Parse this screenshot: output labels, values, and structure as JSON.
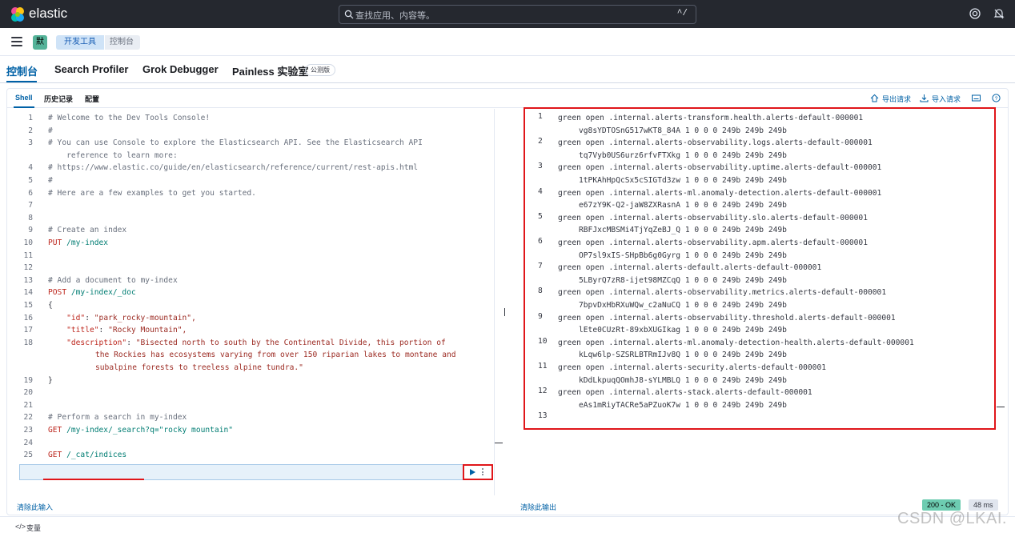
{
  "header": {
    "brand": "elastic",
    "search_placeholder": "查找应用、内容等。",
    "search_shortcut": "^/"
  },
  "breadcrumbs": {
    "space_initial": "默",
    "items": [
      "开发工具",
      "控制台"
    ]
  },
  "app_tabs": [
    {
      "label": "控制台",
      "active": true
    },
    {
      "label": "Search Profiler",
      "active": false
    },
    {
      "label": "Grok Debugger",
      "active": false
    },
    {
      "label": "Painless 实验室",
      "active": false
    }
  ],
  "beta_badge": "公测版",
  "console_tabs": [
    {
      "label": "Shell",
      "active": true
    },
    {
      "label": "历史记录",
      "active": false
    },
    {
      "label": "配置",
      "active": false
    }
  ],
  "toolbar": {
    "export_label": "导出请求",
    "import_label": "导入请求"
  },
  "editor": {
    "lines": [
      {
        "n": "1",
        "text": "# Welcome to the Dev Tools Console!"
      },
      {
        "n": "2",
        "text": "#"
      },
      {
        "n": "3",
        "text": "# You can use Console to explore the Elasticsearch API. See the Elasticsearch API"
      },
      {
        "n": "",
        "text": "    reference to learn more:"
      },
      {
        "n": "4",
        "text": "# https://www.elastic.co/guide/en/elasticsearch/reference/current/rest-apis.html"
      },
      {
        "n": "5",
        "text": "#"
      },
      {
        "n": "6",
        "text": "# Here are a few examples to get you started."
      },
      {
        "n": "7",
        "text": ""
      },
      {
        "n": "8",
        "text": ""
      },
      {
        "n": "9",
        "text": "# Create an index"
      },
      {
        "n": "10",
        "method": "PUT",
        "url": " /my-index"
      },
      {
        "n": "11",
        "text": ""
      },
      {
        "n": "12",
        "text": ""
      },
      {
        "n": "13",
        "text": "# Add a document to my-index"
      },
      {
        "n": "14",
        "method": "POST",
        "url": " /my-index/_doc"
      },
      {
        "n": "15",
        "text": "{"
      },
      {
        "n": "16",
        "key": "\"id\"",
        "val": "\"park_rocky-mountain\","
      },
      {
        "n": "17",
        "key": "\"title\"",
        "val": "\"Rocky Mountain\","
      },
      {
        "n": "18",
        "key": "\"description\"",
        "val": "\"Bisected north to south by the Continental Divide, this portion of"
      },
      {
        "n": "",
        "str": "the Rockies has ecosystems varying from over 150 riparian lakes to montane and"
      },
      {
        "n": "",
        "str": "subalpine forests to treeless alpine tundra.\""
      },
      {
        "n": "19",
        "text": "}"
      },
      {
        "n": "20",
        "text": ""
      },
      {
        "n": "21",
        "text": ""
      },
      {
        "n": "22",
        "text": "# Perform a search in my-index"
      },
      {
        "n": "23",
        "method": "GET",
        "url": " /my-index/_search?q=\"rocky mountain\""
      },
      {
        "n": "24",
        "text": ""
      },
      {
        "n": "25",
        "method": "GET",
        "url": " /_cat/indices",
        "active": true
      }
    ],
    "clear_label": "清除此输入"
  },
  "output": {
    "lines": [
      {
        "n": "1",
        "a": "green open .internal.alerts-transform.health.alerts-default-000001",
        "b": "vg8sYDTOSnG517wKT8_84A 1 0 0 0 249b 249b 249b"
      },
      {
        "n": "2",
        "a": "green open .internal.alerts-observability.logs.alerts-default-000001",
        "b": "tq7Vyb0US6urz6rfvFTXkg 1 0 0 0 249b 249b 249b"
      },
      {
        "n": "3",
        "a": "green open .internal.alerts-observability.uptime.alerts-default-000001",
        "b": "1tPKAhHpQcSx5cSIGTd3zw 1 0 0 0 249b 249b 249b"
      },
      {
        "n": "4",
        "a": "green open .internal.alerts-ml.anomaly-detection.alerts-default-000001",
        "b": "e67zY9K-Q2-jaW8ZXRasnA 1 0 0 0 249b 249b 249b"
      },
      {
        "n": "5",
        "a": "green open .internal.alerts-observability.slo.alerts-default-000001",
        "b": "RBFJxcMBSMi4TjYqZeBJ_Q 1 0 0 0 249b 249b 249b"
      },
      {
        "n": "6",
        "a": "green open .internal.alerts-observability.apm.alerts-default-000001",
        "b": "OP7sl9xIS-SHpBb6g0Gyrg 1 0 0 0 249b 249b 249b"
      },
      {
        "n": "7",
        "a": "green open .internal.alerts-default.alerts-default-000001",
        "b": "5LByrQ7zR8-ijet98MZCqQ 1 0 0 0 249b 249b 249b"
      },
      {
        "n": "8",
        "a": "green open .internal.alerts-observability.metrics.alerts-default-000001",
        "b": "7bpvDxHbRXuWQw_c2aNuCQ 1 0 0 0 249b 249b 249b"
      },
      {
        "n": "9",
        "a": "green open .internal.alerts-observability.threshold.alerts-default-000001",
        "b": "lEte0CUzRt-89xbXUGIkag 1 0 0 0 249b 249b 249b"
      },
      {
        "n": "10",
        "a": "green open .internal.alerts-ml.anomaly-detection-health.alerts-default-000001",
        "b": "kLqw6lp-SZSRLBTRmIJv8Q 1 0 0 0 249b 249b 249b"
      },
      {
        "n": "11",
        "a": "green open .internal.alerts-security.alerts-default-000001",
        "b": "kDdLkpuqQOmhJ8-sYLMBLQ 1 0 0 0 249b 249b 249b"
      },
      {
        "n": "12",
        "a": "green open .internal.alerts-stack.alerts-default-000001",
        "b": "eAs1mRiyTACRe5aPZuoK7w 1 0 0 0 249b 249b 249b"
      },
      {
        "n": "13",
        "a": "",
        "b": ""
      }
    ],
    "clear_label": "清除此输出",
    "status": "200 - OK",
    "duration": "48 ms"
  },
  "footer": {
    "variables_label": "变量",
    "variables_icon": "</>"
  },
  "watermark": "CSDN @LKAI.",
  "colors": {
    "accent": "#0061a6",
    "highlight_red": "#e0161a",
    "status_ok": "#6dccb1"
  }
}
